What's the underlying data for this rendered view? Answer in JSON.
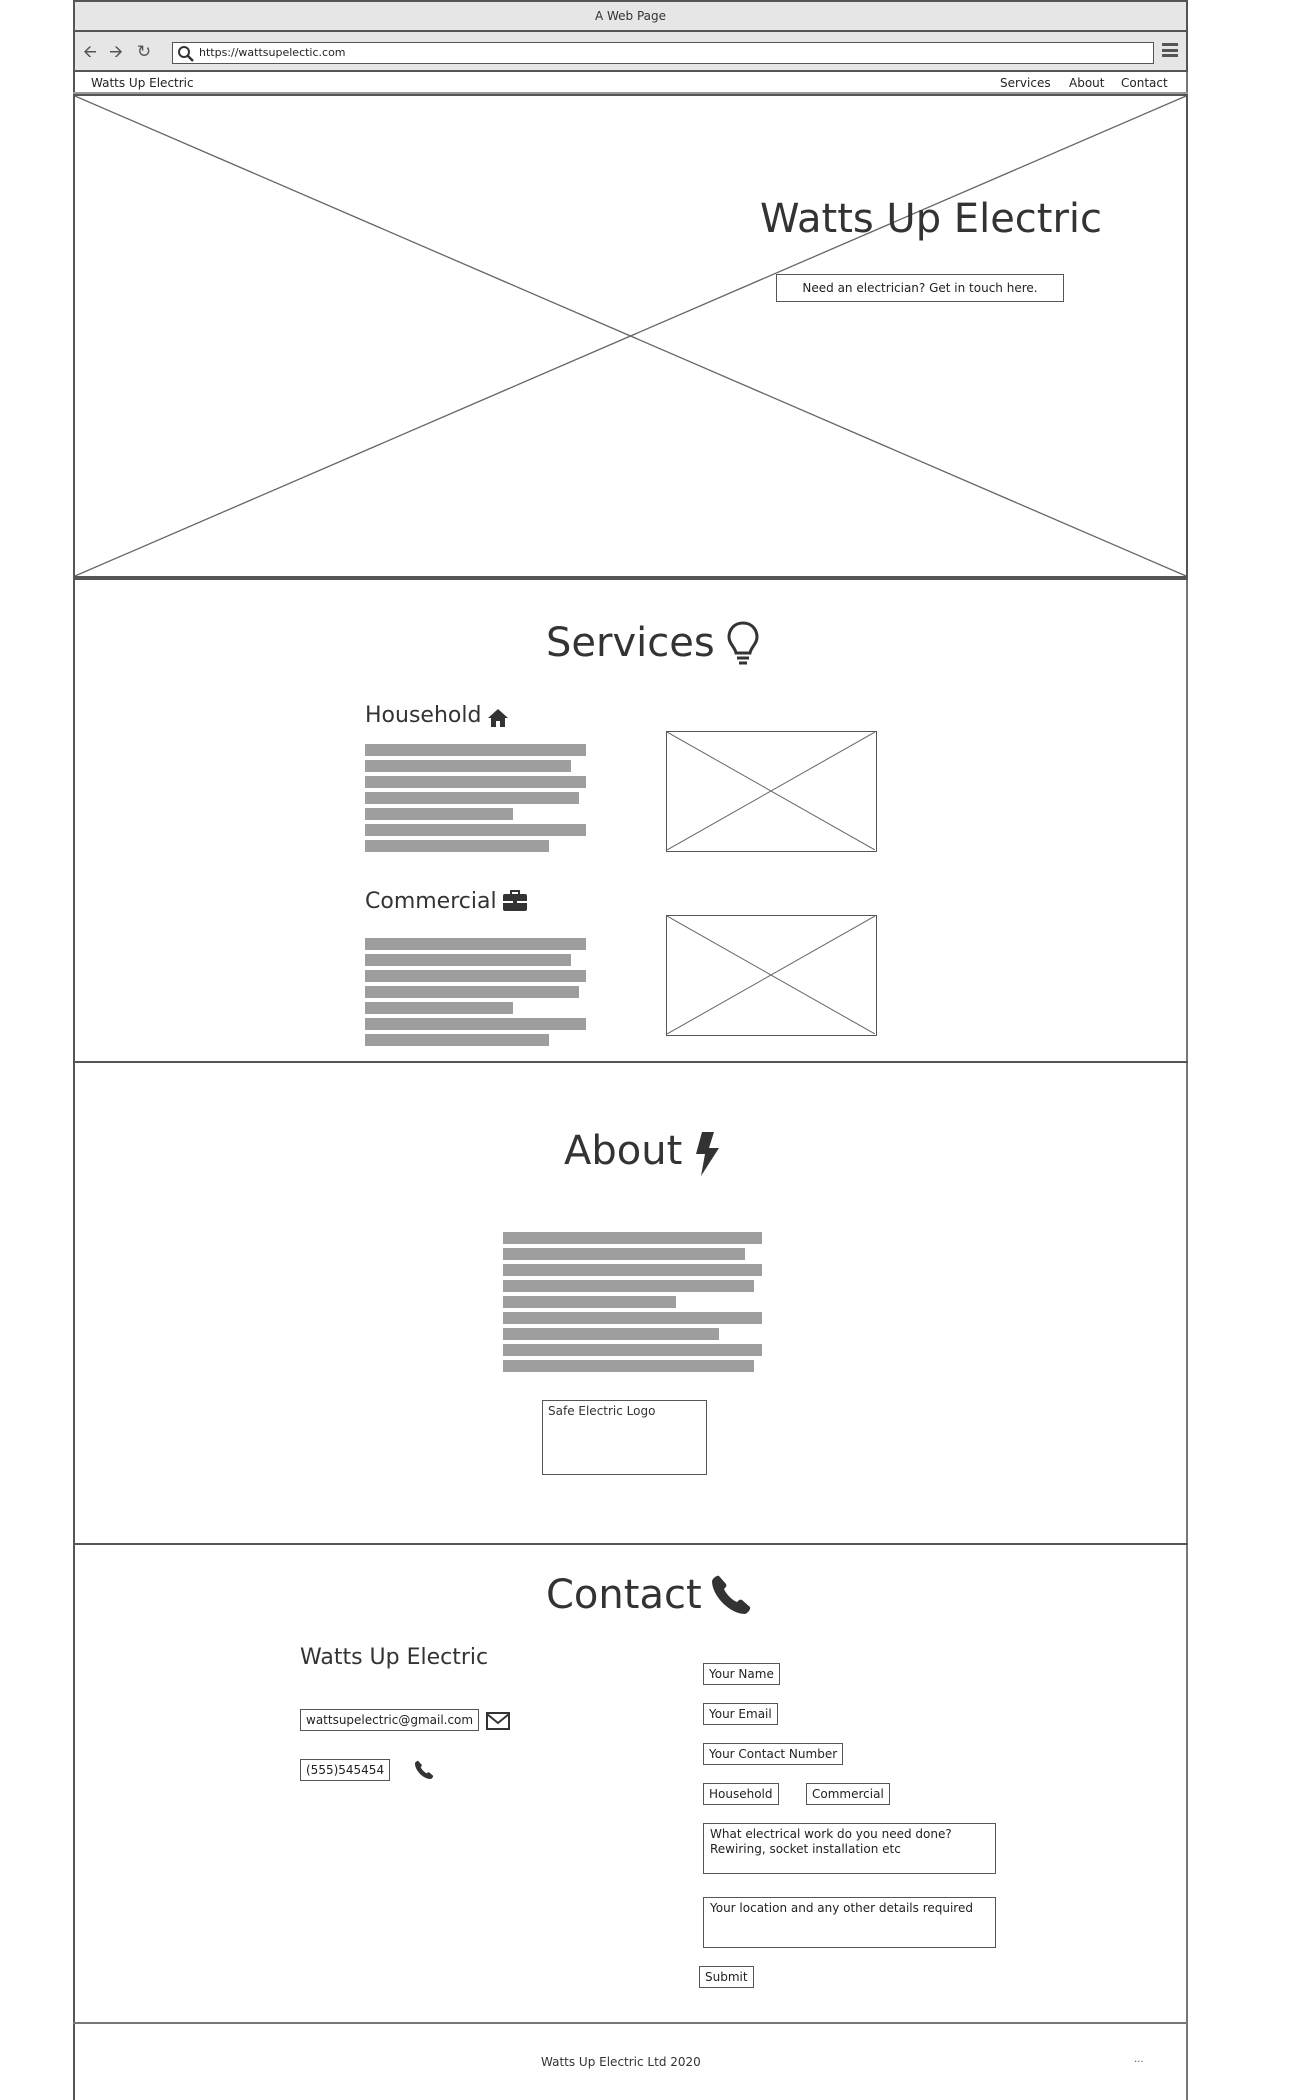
{
  "browser": {
    "window_title": "A Web Page",
    "url": "https://wattsupelectic.com"
  },
  "nav": {
    "brand": "Watts Up Electric",
    "links": [
      "Services",
      "About",
      "Contact"
    ]
  },
  "hero": {
    "title": "Watts Up Electric",
    "cta_label": "Need an electrician? Get in touch here."
  },
  "services": {
    "title": "Services",
    "icon": "lightbulb-icon",
    "items": [
      {
        "title": "Household",
        "icon": "home-icon"
      },
      {
        "title": "Commercial",
        "icon": "briefcase-icon"
      }
    ]
  },
  "about": {
    "title": "About",
    "icon": "lightning-bolt-icon",
    "logo_label": "Safe Electric Logo"
  },
  "contact": {
    "title": "Contact",
    "icon": "phone-icon",
    "company": "Watts Up Electric",
    "email": "wattsupelectric@gmail.com",
    "phone": "(555)545454",
    "form": {
      "name": "Your Name",
      "email": "Your Email",
      "number": "Your Contact Number",
      "option_household": "Household",
      "option_commercial": "Commercial",
      "work": "What electrical work do you need done?\nRewiring, socket installation etc",
      "location": "Your location and any other details required",
      "submit": "Submit"
    }
  },
  "footer": {
    "text": "Watts Up Electric Ltd 2020",
    "dots": "..."
  }
}
